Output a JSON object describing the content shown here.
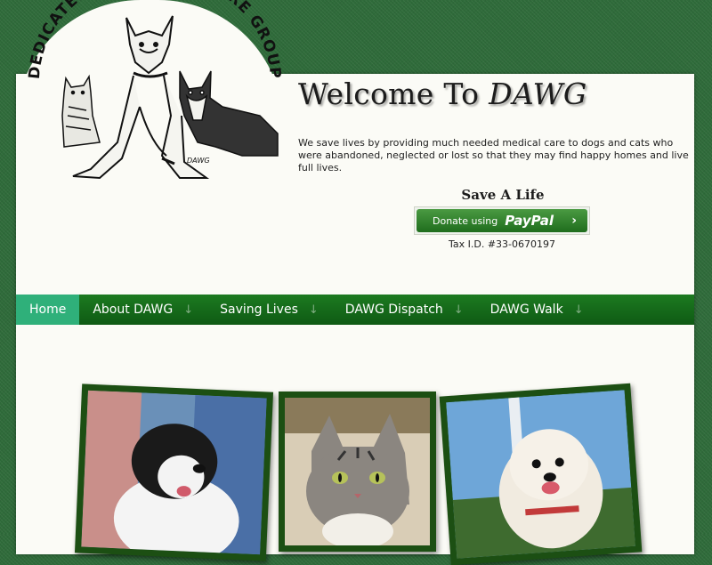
{
  "logo": {
    "arc_text": "DEDICATED ANIMAL WELFARE GROUP",
    "sig": "DAWG"
  },
  "header": {
    "welcome_prefix": "Welcome To",
    "welcome_brand": "DAWG",
    "mission": "We save lives by providing much needed medical care to dogs and cats who were abandoned, neglected or lost so that they may find happy homes and live full lives."
  },
  "donate": {
    "heading": "Save A Life",
    "button_text": "Donate using",
    "brand": "PayPal",
    "tax_id": "Tax I.D. #33-0670197"
  },
  "nav": {
    "items": [
      {
        "label": "Home"
      },
      {
        "label": "About DAWG"
      },
      {
        "label": "Saving Lives"
      },
      {
        "label": "DAWG Dispatch"
      },
      {
        "label": "DAWG Walk"
      }
    ]
  },
  "colors": {
    "background": "#2f6b3a",
    "nav": "#1c7a20",
    "nav_active": "#2fb07a",
    "photo_frame": "#1c4f13"
  }
}
